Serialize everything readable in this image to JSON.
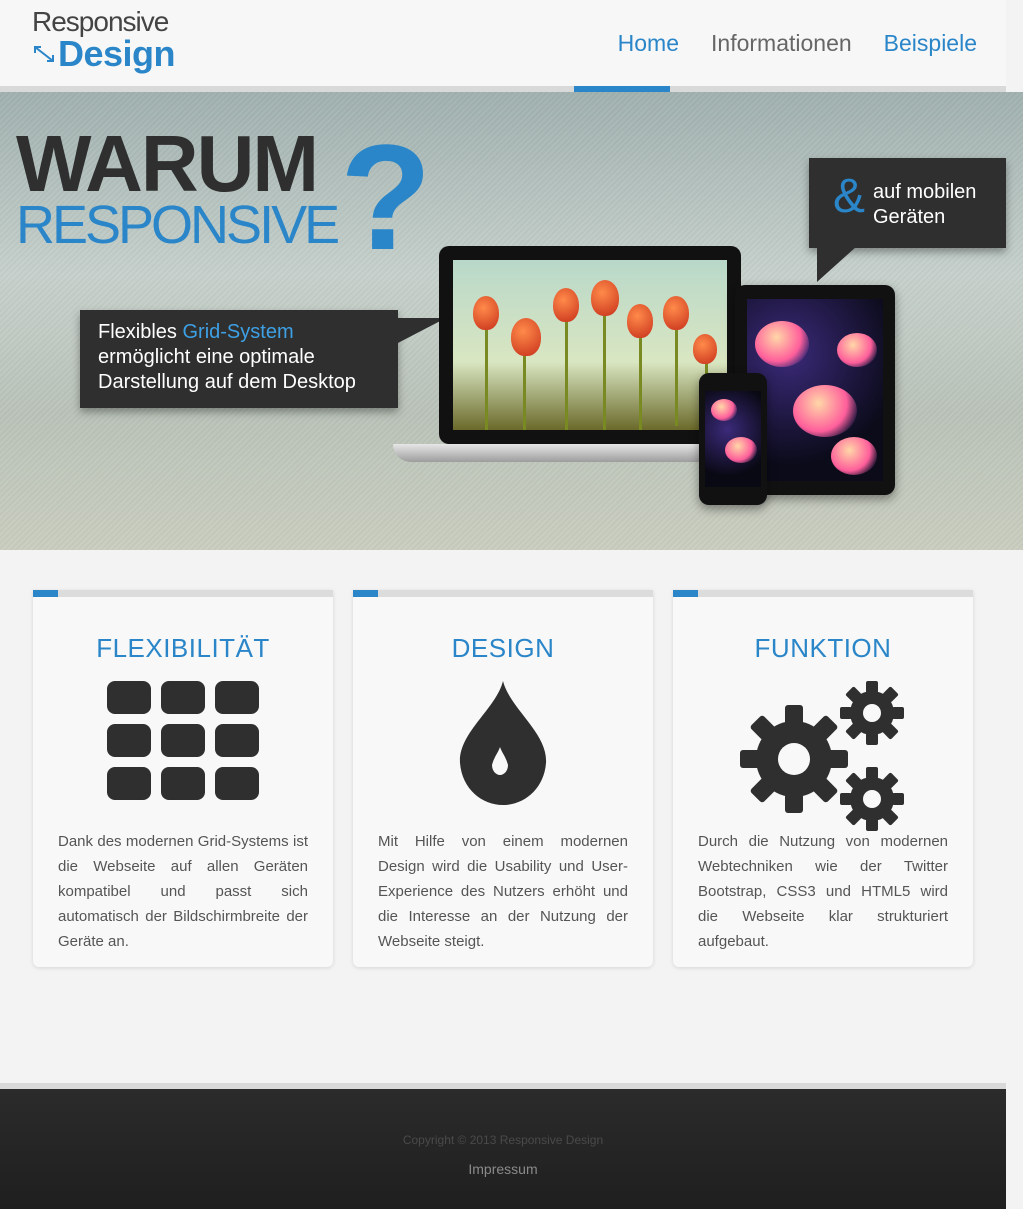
{
  "logo": {
    "line1": "Responsive",
    "line2": "Design"
  },
  "nav": {
    "items": [
      {
        "label": "Home"
      },
      {
        "label": "Informationen"
      },
      {
        "label": "Beispiele"
      }
    ]
  },
  "hero": {
    "headline": "WARUM",
    "subheadline": "RESPONSIVE",
    "question_mark": "?",
    "callout_left": {
      "line1_prefix": "Flexibles ",
      "line1_accent": "Grid-System",
      "line2": "ermöglicht eine optimale",
      "line3": "Darstellung auf dem Desktop"
    },
    "callout_right": {
      "symbol": "&",
      "line1": "auf mobilen",
      "line2": "Geräten"
    }
  },
  "features": [
    {
      "title": "FLEXIBILITÄT",
      "icon": "grid-icon",
      "text": "Dank des modernen Grid-Systems ist die Webseite auf allen Geräten kompatibel und passt sich automatisch der Bildschirmbreite der Geräte an."
    },
    {
      "title": "DESIGN",
      "icon": "drop-icon",
      "text": "Mit Hilfe von einem modernen Design wird die Usability und User-Experience des Nutzers erhöht und die Interesse an der Nutzung der Webseite steigt."
    },
    {
      "title": "FUNKTION",
      "icon": "gears-icon",
      "text": "Durch die Nutzung von modernen Webtechniken wie der Twitter Bootstrap, CSS3 und HTML5 wird die Webseite klar strukturiert aufgebaut."
    }
  ],
  "footer": {
    "copyright": "Copyright © 2013 Responsive Design",
    "impressum": "Impressum"
  },
  "colors": {
    "accent": "#2a86c8",
    "dark": "#2f2f2f",
    "footer": "#242424"
  }
}
